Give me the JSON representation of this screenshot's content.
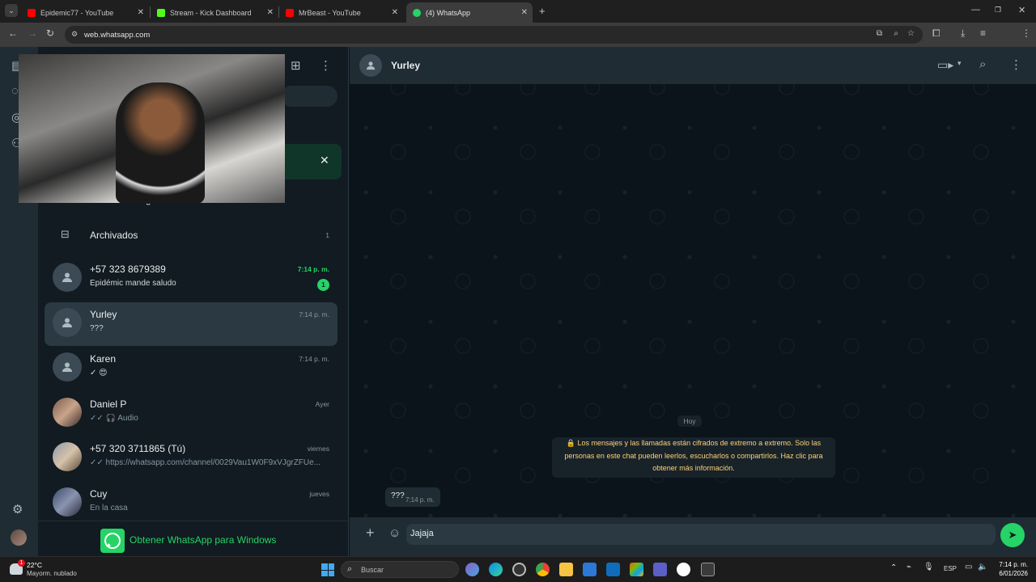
{
  "browser": {
    "tabs": [
      {
        "title": "Epidemic77 - YouTube",
        "color": "#ff0000"
      },
      {
        "title": "Stream - Kick Dashboard",
        "color": "#53fc18"
      },
      {
        "title": "MrBeast - YouTube",
        "color": "#ff0000"
      },
      {
        "title": "(4) WhatsApp",
        "color": "#25d366"
      }
    ],
    "url": "web.whatsapp.com"
  },
  "sidebar": {
    "restricted_label": "Chats restringidos",
    "archived_label": "Archivados",
    "archived_count": "1",
    "chats": [
      {
        "name": "+57 323 8679389",
        "message": "Epidémic mande saludo",
        "time": "7:14 p. m.",
        "unread": "1"
      },
      {
        "name": "Yurley",
        "message": "???",
        "time": "7:14 p. m."
      },
      {
        "name": "Karen",
        "message": "✓ 😍",
        "time": "7:14 p. m."
      },
      {
        "name": "Daniel P",
        "message": "✓✓ 🎧 Audio",
        "time": "Ayer"
      },
      {
        "name": "+57 320 3711865 (Tú)",
        "message": "✓✓ https://whatsapp.com/channel/0029Vau1W0F9xVJgrZFUe...",
        "time": "viernes"
      },
      {
        "name": "Cuy",
        "message": "En la casa",
        "time": "jueves"
      }
    ],
    "get_app_label": "Obtener WhatsApp para Windows"
  },
  "chat": {
    "contact_name": "Yurley",
    "date_chip": "Hoy",
    "encryption_notice": "🔒 Los mensajes y las llamadas están cifrados de extremo a extremo. Solo las personas en este chat pueden leerlos, escucharlos o compartirlos. Haz clic para obtener más información.",
    "messages": [
      {
        "text": "???",
        "time": "7:14 p. m."
      }
    ],
    "composer_value": "Jajaja"
  },
  "taskbar": {
    "weather_temp": "22°C",
    "weather_desc": "Mayorm. nublado",
    "weather_alert": "1",
    "search_placeholder": "Buscar",
    "lang": "ESP",
    "time": "7:14 p. m.",
    "date": "6/01/2026"
  }
}
